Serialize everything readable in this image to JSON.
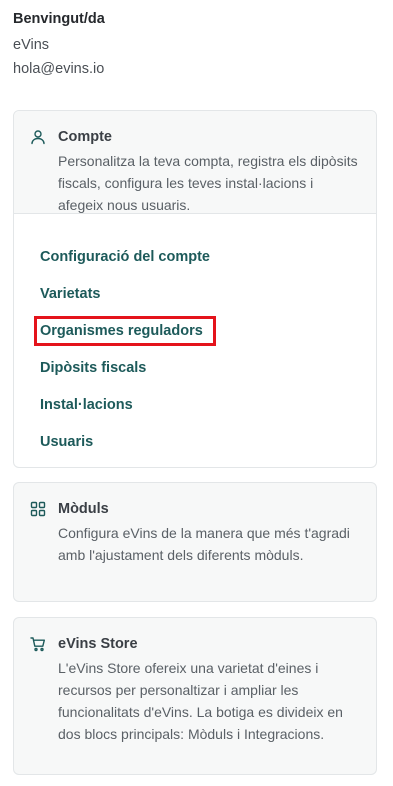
{
  "welcome": {
    "title": "Benvingut/da",
    "name": "eVins",
    "email": "hola@evins.io"
  },
  "account_card": {
    "icon": "user-icon",
    "title": "Compte",
    "description": "Personalitza la teva compta, registra els dipòsits fiscals, configura les teves instal·lacions i afegeix nous usuaris.",
    "links": [
      "Configuració del compte",
      "Varietats",
      "Organismes reguladors",
      "Dipòsits fiscals",
      "Instal·lacions",
      "Usuaris"
    ],
    "highlighted_link": "Organismes reguladors"
  },
  "modules_card": {
    "icon": "grid-icon",
    "title": "Mòduls",
    "description": "Configura eVins de la manera que més t'agradi amb l'ajustament dels diferents mòduls."
  },
  "store_card": {
    "icon": "cart-icon",
    "title": "eVins Store",
    "description": "L'eVins Store ofereix una varietat d'eines i recursos per personaltizar i ampliar les funcionalitats d'eVins. La botiga es divideix en dos blocs principals: Mòduls i Integracions."
  },
  "colors": {
    "link": "#1d5a5a",
    "highlight": "#e4131b",
    "card_bg": "#f7f8f8",
    "border": "#e3e6e8"
  }
}
